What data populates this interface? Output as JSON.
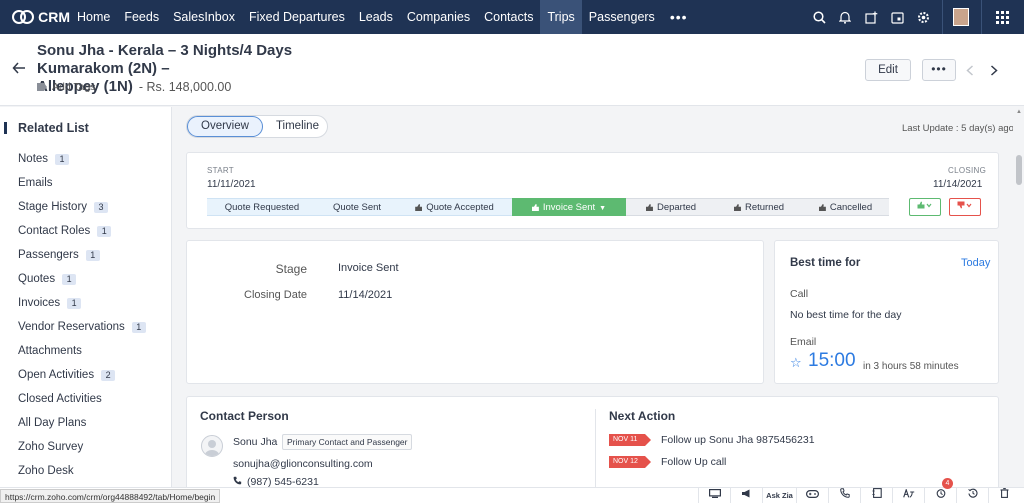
{
  "nav": {
    "brand": "CRM",
    "items": [
      "Home",
      "Feeds",
      "SalesInbox",
      "Fixed Departures",
      "Leads",
      "Companies",
      "Contacts",
      "Trips",
      "Passengers"
    ],
    "active": "Trips",
    "more": "•••"
  },
  "record": {
    "title_line1": "Sonu Jha - Kerala – 3 Nights/4 Days Kumarakom (2N) –",
    "title_line2": "Alleppey (1N)",
    "price": "- Rs. 148,000.00",
    "add_tags": "Add Tags",
    "edit_label": "Edit",
    "more_label": "•••"
  },
  "sidebar": {
    "heading": "Related List",
    "items": [
      {
        "label": "Notes",
        "count": "1"
      },
      {
        "label": "Emails",
        "count": ""
      },
      {
        "label": "Stage History",
        "count": "3"
      },
      {
        "label": "Contact Roles",
        "count": "1"
      },
      {
        "label": "Passengers",
        "count": "1"
      },
      {
        "label": "Quotes",
        "count": "1"
      },
      {
        "label": "Invoices",
        "count": "1"
      },
      {
        "label": "Vendor Reservations",
        "count": "1"
      },
      {
        "label": "Attachments",
        "count": ""
      },
      {
        "label": "Open Activities",
        "count": "2"
      },
      {
        "label": "Closed Activities",
        "count": ""
      },
      {
        "label": "All Day Plans",
        "count": ""
      },
      {
        "label": "Zoho Survey",
        "count": ""
      },
      {
        "label": "Zoho Desk",
        "count": ""
      }
    ]
  },
  "tabs": {
    "overview": "Overview",
    "timeline": "Timeline"
  },
  "last_update": "Last Update : 5 day(s) ago",
  "stage_bar": {
    "start_label": "START",
    "start_date": "11/11/2021",
    "closing_label": "CLOSING",
    "closing_date": "11/14/2021",
    "steps": [
      "Quote Requested",
      "Quote Sent",
      "Quote Accepted",
      "Invoice Sent",
      "Departed",
      "Returned",
      "Cancelled"
    ],
    "current": "Invoice Sent"
  },
  "details": {
    "stage_label": "Stage",
    "stage_value": "Invoice Sent",
    "closing_label": "Closing Date",
    "closing_value": "11/14/2021"
  },
  "best_time": {
    "title": "Best time for",
    "today": "Today",
    "call_label": "Call",
    "call_text": "No best time for the day",
    "email_label": "Email",
    "email_time": "15:00",
    "email_in": "in 3 hours 58 minutes"
  },
  "contact": {
    "title": "Contact Person",
    "name": "Sonu Jha",
    "role": "Primary Contact and Passenger",
    "email": "sonujha@glionconsulting.com",
    "phone": "(987) 545-6231"
  },
  "next_action": {
    "title": "Next Action",
    "items": [
      {
        "date": "NOV 11",
        "text": "Follow up Sonu Jha 9875456231"
      },
      {
        "date": "NOV 12",
        "text": "Follow Up call"
      }
    ]
  },
  "status_url": "https://crm.zoho.com/crm/org44888492/tab/Home/begin",
  "bottom": {
    "ask_zia": "Ask Zia",
    "notif_count": "4"
  },
  "colors": {
    "nav_bg": "#1f3354",
    "accent": "#2d7be1",
    "stage_current": "#5dba71",
    "danger": "#e5524b"
  }
}
